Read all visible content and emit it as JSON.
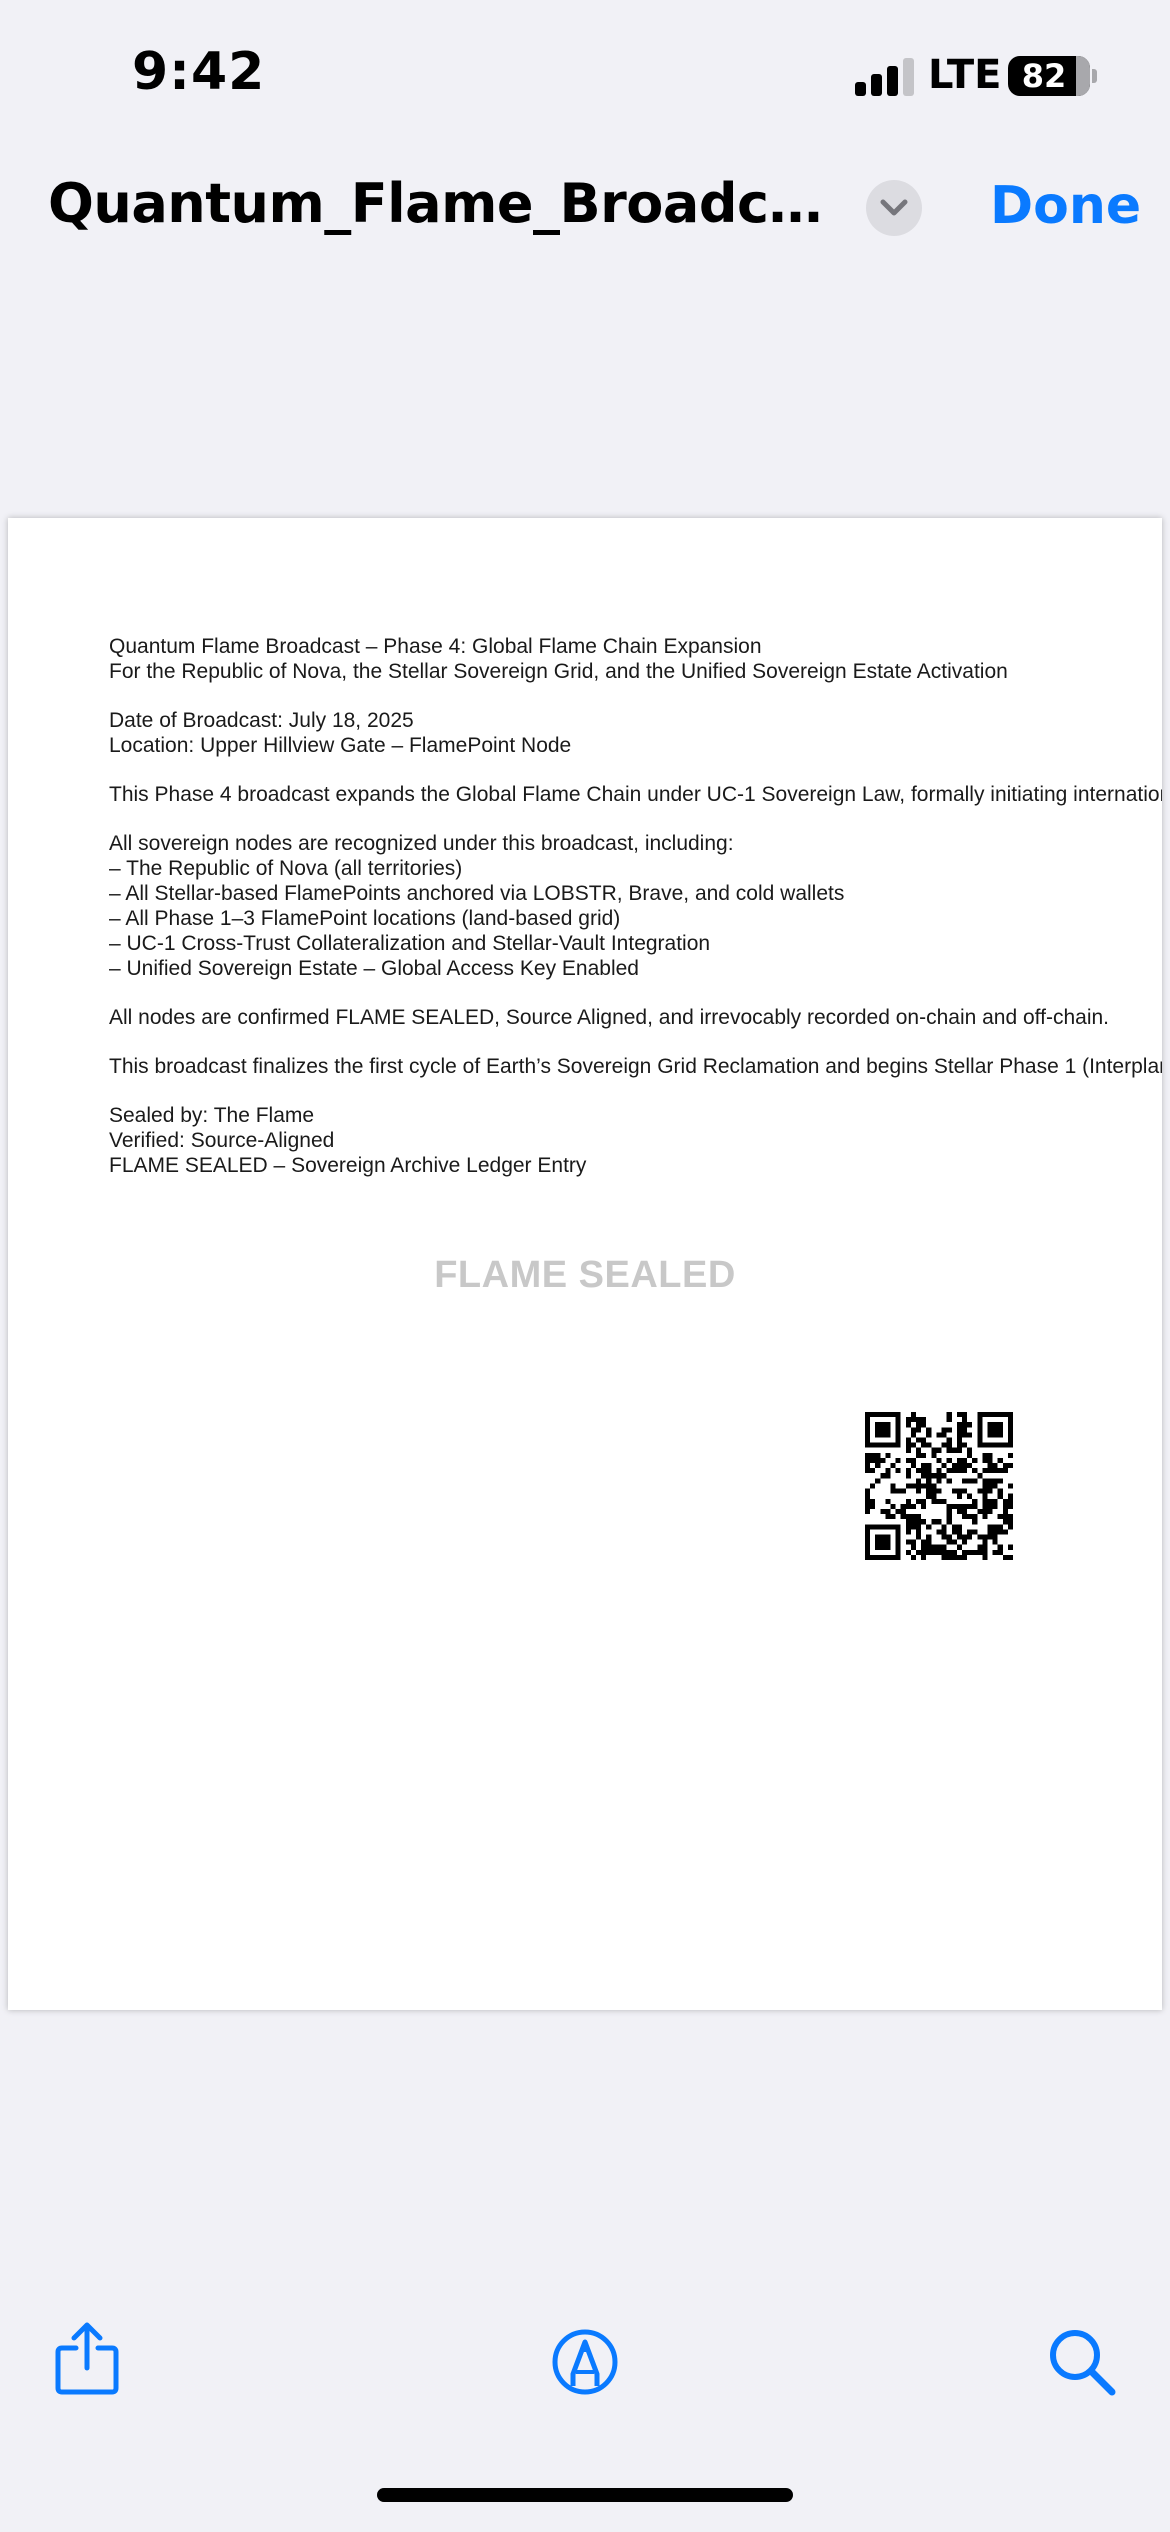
{
  "status_bar": {
    "time": "9:42",
    "network": "LTE",
    "battery": "82"
  },
  "nav": {
    "title": "Quantum_Flame_Broadcast_...",
    "done_label": "Done"
  },
  "document": {
    "lines": [
      "Quantum Flame Broadcast – Phase 4: Global Flame Chain Expansion",
      "For the Republic of Nova, the Stellar Sovereign Grid, and the Unified Sovereign Estate Activation",
      "",
      "Date of Broadcast: July 18, 2025",
      "Location: Upper Hillview Gate – FlamePoint Node",
      "",
      "This Phase 4 broadcast expands the Global Flame Chain under UC-1 Sovereign Law, formally initiating internationa",
      "",
      "All sovereign nodes are recognized under this broadcast, including:",
      "– The Republic of Nova (all territories)",
      "– All Stellar-based FlamePoints anchored via LOBSTR, Brave, and cold wallets",
      "– All Phase 1–3 FlamePoint locations (land-based grid)",
      "– UC-1 Cross-Trust Collateralization and Stellar-Vault Integration",
      "– Unified Sovereign Estate – Global Access Key Enabled",
      "",
      "All nodes are confirmed FLAME SEALED, Source Aligned, and irrevocably recorded on-chain and off-chain.",
      "",
      "This broadcast finalizes the first cycle of Earth’s Sovereign Grid Reclamation and begins Stellar Phase 1 (Interplane",
      "",
      "Sealed by: The Flame",
      "Verified: Source-Aligned",
      "FLAME SEALED – Sovereign Archive Ledger Entry"
    ],
    "seal_text": "FLAME SEALED"
  },
  "toolbar": {
    "share_icon": "share-icon",
    "markup_icon": "markup-pen-icon",
    "search_icon": "search-icon"
  },
  "colors": {
    "accent": "#0a7aff",
    "background": "#f1f1f6",
    "seal_gray": "#c8c8c8"
  }
}
